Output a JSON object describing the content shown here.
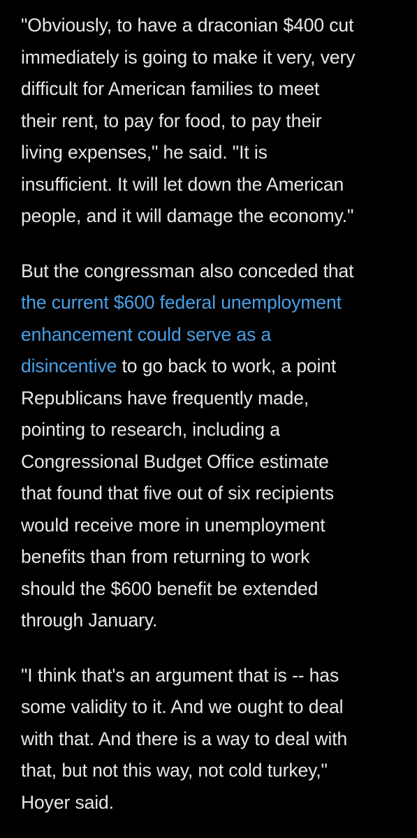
{
  "colors": {
    "background": "#000000",
    "text": "#e8e8e8",
    "link": "#4aa0e8"
  },
  "article": {
    "p1": {
      "lines": [
        "\"Obviously, to have a draconian $400 cut",
        "immediately is going to make it very, very",
        "difficult for American families to meet",
        "their rent, to pay for food, to pay their",
        "living expenses,\" he said. \"It is",
        "insufficient. It will let down the American",
        "people, and it will damage the economy.\""
      ]
    },
    "p2": {
      "line1": "But the congressman also conceded that",
      "link_line1": "the current $600 federal unemployment",
      "link_line2": "enhancement could serve as a",
      "link_line3": "disincentive",
      "line4_rest": " to go back to work, a point",
      "lines": [
        "Republicans have frequently made,",
        "pointing to research, including a",
        "Congressional Budget Office estimate",
        "that found that five out of six recipients",
        "would receive more in unemployment",
        "benefits than from returning to work",
        "should the $600 benefit be extended",
        "through January."
      ]
    },
    "p3": {
      "lines": [
        "\"I think that's an argument that is -- has",
        "some validity to it. And we ought to deal",
        "with that. And there is a way to deal with",
        "that, but not this way, not cold turkey,\"",
        "Hoyer said."
      ]
    }
  }
}
